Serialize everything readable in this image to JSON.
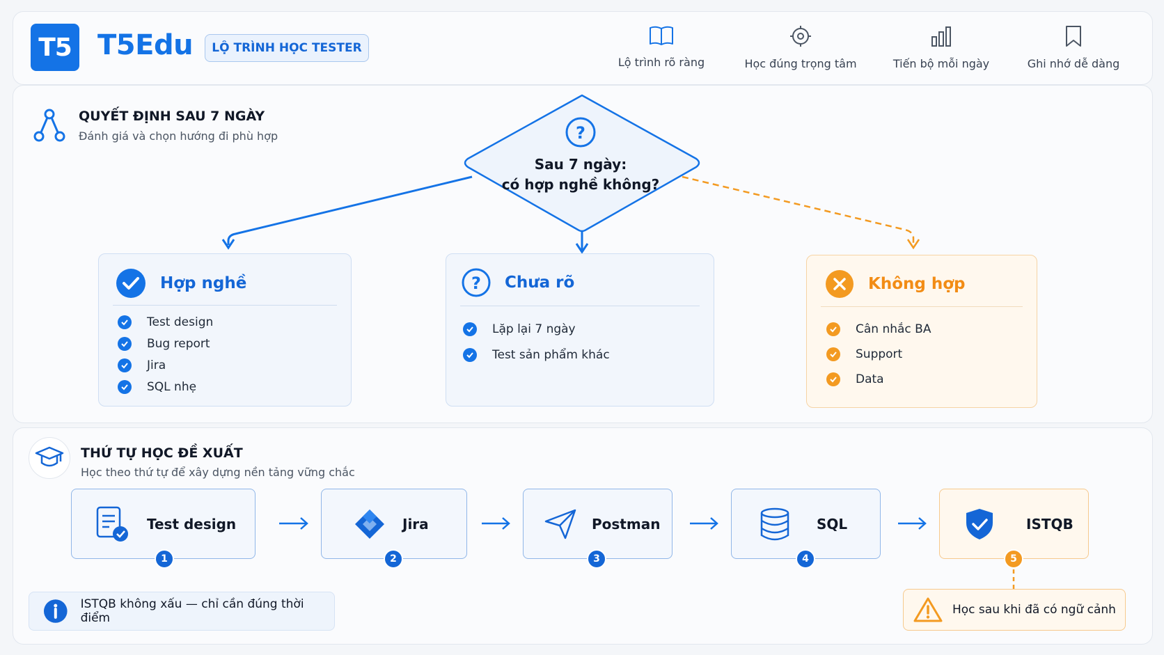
{
  "header": {
    "logo_text": "T5",
    "brand": "T5Edu",
    "tag": "LỘ TRÌNH HỌC TESTER",
    "features": [
      {
        "label": "Lộ trình rõ ràng",
        "icon": "book-icon"
      },
      {
        "label": "Học đúng trọng tâm",
        "icon": "target-icon"
      },
      {
        "label": "Tiến bộ mỗi ngày",
        "icon": "bar-chart-icon"
      },
      {
        "label": "Ghi nhớ dễ dàng",
        "icon": "bookmark-icon"
      }
    ]
  },
  "decision": {
    "title": "QUYẾT ĐỊNH SAU 7 NGÀY",
    "subtitle": "Đánh giá và chọn hướng đi phù hợp",
    "question_line1": "Sau 7 ngày:",
    "question_line2": "có hợp nghề không?",
    "outcomes": [
      {
        "title": "Hợp nghề",
        "items": [
          "Test design",
          "Bug report",
          "Jira",
          "SQL nhẹ"
        ]
      },
      {
        "title": "Chưa rõ",
        "items": [
          "Lặp lại 7 ngày",
          "Test sản phẩm khác"
        ]
      },
      {
        "title": "Không hợp",
        "items": [
          "Cân nhắc BA",
          "Support",
          "Data"
        ]
      }
    ]
  },
  "order": {
    "title": "THỨ TỰ HỌC ĐỀ XUẤT",
    "subtitle": "Học theo thứ tự để xây dựng nền tảng vững chắc",
    "steps": [
      {
        "label": "Test design",
        "num": "1",
        "icon": "checklist-icon"
      },
      {
        "label": "Jira",
        "num": "2",
        "icon": "jira-icon"
      },
      {
        "label": "Postman",
        "num": "3",
        "icon": "paper-plane-icon"
      },
      {
        "label": "SQL",
        "num": "4",
        "icon": "database-icon"
      },
      {
        "label": "ISTQB",
        "num": "5",
        "icon": "shield-icon"
      }
    ],
    "info_note": "ISTQB không xấu — chỉ cần đúng thời điểm",
    "warning_note": "Học sau khi đã có ngữ cảnh"
  },
  "colors": {
    "blue": "#1473e6",
    "orange": "#f39a21"
  }
}
